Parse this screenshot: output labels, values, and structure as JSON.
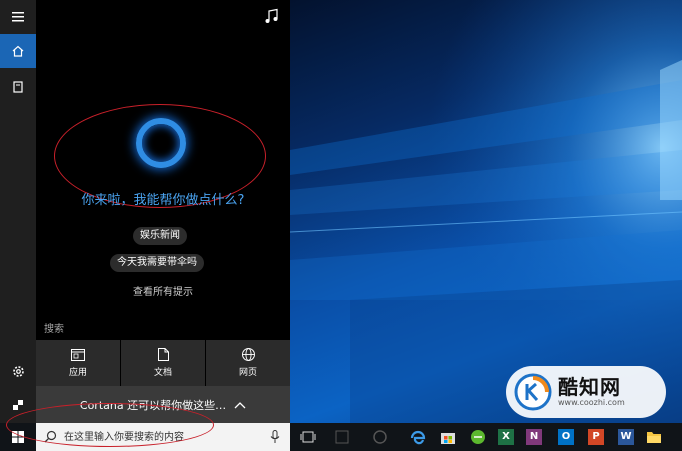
{
  "cortana": {
    "greeting": "你来啦，我能帮你做点什么?",
    "suggestions": [
      "娱乐新闻",
      "今天我需要带伞吗"
    ],
    "see_all": "查看所有提示",
    "search_section_label": "搜索",
    "categories": [
      {
        "label": "应用",
        "icon": "app-window-icon"
      },
      {
        "label": "文档",
        "icon": "document-icon"
      },
      {
        "label": "网页",
        "icon": "globe-icon"
      }
    ],
    "more_label": "Cortana 还可以帮你做这些…",
    "ring_color": "#2f8de4",
    "greeting_color": "#4aa3f0"
  },
  "rail": {
    "items": [
      "hamburger-menu-icon",
      "home-icon",
      "notebook-icon",
      "settings-icon",
      "feedback-icon"
    ],
    "accent_color": "#1b66b5"
  },
  "taskbar": {
    "search_placeholder": "在这里输入你要搜索的内容",
    "apps": [
      {
        "name": "task-view"
      },
      {
        "name": "app-blank-1"
      },
      {
        "name": "app-blank-2"
      },
      {
        "name": "edge"
      },
      {
        "name": "store"
      },
      {
        "name": "green-app"
      },
      {
        "name": "excel",
        "letter": "X",
        "color": "#1e7145"
      },
      {
        "name": "onenote",
        "letter": "N",
        "color": "#80397b"
      },
      {
        "name": "outlook",
        "letter": "O",
        "color": "#0072c6"
      },
      {
        "name": "powerpoint",
        "letter": "P",
        "color": "#d24726"
      },
      {
        "name": "word",
        "letter": "W",
        "color": "#2b579a"
      },
      {
        "name": "file-explorer"
      }
    ]
  },
  "watermark": {
    "title": "酷知网",
    "url": "www.coozhi.com"
  }
}
